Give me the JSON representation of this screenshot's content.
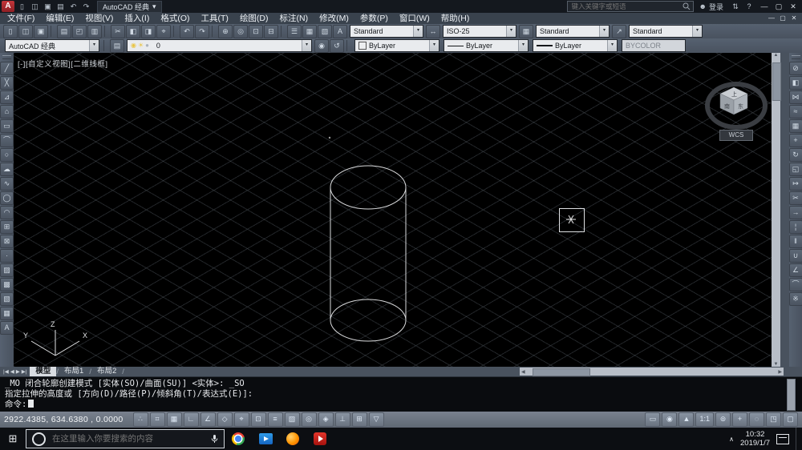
{
  "titlebar": {
    "workspace_label": "AutoCAD 经典",
    "search_placeholder": "键入关键字或短语",
    "signin_label": "登录",
    "qat_icons": [
      {
        "name": "qat-new",
        "g": "▯"
      },
      {
        "name": "qat-open",
        "g": "◫"
      },
      {
        "name": "qat-save",
        "g": "▣"
      },
      {
        "name": "qat-plot",
        "g": "▤"
      },
      {
        "name": "qat-undo",
        "g": "↶"
      },
      {
        "name": "qat-redo",
        "g": "↷"
      }
    ],
    "right_icons": [
      {
        "name": "exchange-apps",
        "g": "⇅"
      },
      {
        "name": "help",
        "g": "?"
      }
    ],
    "window_buttons": [
      {
        "name": "minimize",
        "g": "—"
      },
      {
        "name": "maximize",
        "g": "▢"
      },
      {
        "name": "close",
        "g": "✕"
      }
    ]
  },
  "menubar": {
    "items": [
      "文件(F)",
      "编辑(E)",
      "视图(V)",
      "插入(I)",
      "格式(O)",
      "工具(T)",
      "绘图(D)",
      "标注(N)",
      "修改(M)",
      "参数(P)",
      "窗口(W)",
      "帮助(H)"
    ],
    "doc_window_buttons": [
      {
        "name": "doc-minimize",
        "g": "—"
      },
      {
        "name": "doc-restore",
        "g": "▢"
      },
      {
        "name": "doc-close",
        "g": "✕"
      }
    ]
  },
  "toolbar_style": {
    "icons": [
      {
        "name": "qnew",
        "g": "▯"
      },
      {
        "name": "open",
        "g": "◫"
      },
      {
        "name": "save",
        "g": "▣"
      },
      {
        "sep": true
      },
      {
        "name": "plot",
        "g": "▤"
      },
      {
        "name": "plot-preview",
        "g": "◰"
      },
      {
        "name": "publish",
        "g": "▥"
      },
      {
        "sep": true
      },
      {
        "name": "cut",
        "g": "✂"
      },
      {
        "name": "copy-clip",
        "g": "◧"
      },
      {
        "name": "paste",
        "g": "◨"
      },
      {
        "name": "match-properties",
        "g": "⌖"
      },
      {
        "sep": true
      },
      {
        "name": "undo",
        "g": "↶"
      },
      {
        "name": "redo",
        "g": "↷"
      },
      {
        "sep": true
      },
      {
        "name": "pan-realtime",
        "g": "⊕"
      },
      {
        "name": "zoom-realtime",
        "g": "◎"
      },
      {
        "name": "zoom-window",
        "g": "⊡"
      },
      {
        "name": "zoom-previous",
        "g": "⊟"
      },
      {
        "sep": true
      },
      {
        "name": "properties-palette",
        "g": "☰"
      },
      {
        "name": "design-center",
        "g": "▦"
      },
      {
        "name": "tool-palettes",
        "g": "▧"
      }
    ],
    "combos": {
      "text_style": {
        "label": "Standard",
        "icon": "A"
      },
      "dim_style": {
        "label": "ISO-25",
        "icon": "↔"
      },
      "table_style": {
        "label": "Standard",
        "icon": "▦"
      },
      "mleader_style": {
        "label": "Standard",
        "icon": "↗"
      }
    }
  },
  "toolbar_props": {
    "workspace_label": "AutoCAD 经典",
    "layer_buttons_left": [
      {
        "name": "layer-properties",
        "g": "▤"
      }
    ],
    "layer_statuses": [
      {
        "name": "layer-on",
        "g": "◉",
        "c": "#e9c546"
      },
      {
        "name": "layer-freeze",
        "g": "☀",
        "c": "#e9c546"
      },
      {
        "name": "layer-lock",
        "g": "●",
        "c": "#aab3bd"
      },
      {
        "name": "layer-color",
        "g": "■",
        "c": "#eceef0"
      }
    ],
    "layer_value": "0",
    "layer_buttons_right": [
      {
        "name": "make-object-layer-current",
        "g": "◉"
      },
      {
        "name": "layer-previous",
        "g": "↺"
      }
    ],
    "color_label": "ByLayer",
    "linetype_label": "ByLayer",
    "lineweight_label": "ByLayer",
    "plot_style_label": "BYCOLOR"
  },
  "draw_toolbar": {
    "items": [
      {
        "name": "line",
        "g": "╱"
      },
      {
        "name": "construction-line",
        "g": "╳"
      },
      {
        "name": "polyline",
        "g": "⊿"
      },
      {
        "name": "polygon",
        "g": "⌂"
      },
      {
        "name": "rectangle",
        "g": "▭"
      },
      {
        "name": "arc",
        "g": "⌒"
      },
      {
        "name": "circle",
        "g": "○"
      },
      {
        "name": "revision-cloud",
        "g": "☁"
      },
      {
        "name": "spline",
        "g": "∿"
      },
      {
        "name": "ellipse",
        "g": "◯"
      },
      {
        "name": "ellipse-arc",
        "g": "◠"
      },
      {
        "name": "insert-block",
        "g": "⊞"
      },
      {
        "name": "make-block",
        "g": "⊠"
      },
      {
        "name": "point",
        "g": "∙"
      },
      {
        "name": "hatch",
        "g": "▨"
      },
      {
        "name": "gradient",
        "g": "▩"
      },
      {
        "name": "region",
        "g": "▧"
      },
      {
        "name": "table",
        "g": "▦"
      },
      {
        "name": "multiline-text",
        "g": "A"
      }
    ]
  },
  "modify_toolbar": {
    "items": [
      {
        "name": "erase",
        "g": "⊘"
      },
      {
        "name": "copy",
        "g": "◧"
      },
      {
        "name": "mirror",
        "g": "⋈"
      },
      {
        "name": "offset",
        "g": "≈"
      },
      {
        "name": "array",
        "g": "▦"
      },
      {
        "name": "move",
        "g": "+"
      },
      {
        "name": "rotate",
        "g": "↻"
      },
      {
        "name": "scale",
        "g": "◱"
      },
      {
        "name": "stretch",
        "g": "↦"
      },
      {
        "name": "trim",
        "g": "✂"
      },
      {
        "name": "extend",
        "g": "→"
      },
      {
        "name": "break-at-point",
        "g": "¦"
      },
      {
        "name": "break",
        "g": "‖"
      },
      {
        "name": "join",
        "g": "∪"
      },
      {
        "name": "chamfer",
        "g": "∠"
      },
      {
        "name": "fillet",
        "g": "⌒"
      },
      {
        "name": "explode",
        "g": "※"
      }
    ]
  },
  "viewport": {
    "controls_label": "[-][自定义视图][二维线框]",
    "wcs_label": "WCS",
    "cube": {
      "top": "上",
      "left": "南",
      "right": "东"
    },
    "axes": {
      "x": "X",
      "y": "Y",
      "z": "Z"
    }
  },
  "tabs": {
    "items": [
      "模型",
      "布局1",
      "布局2"
    ],
    "active": "模型",
    "nav": [
      {
        "name": "first-tab",
        "g": "|◀"
      },
      {
        "name": "prev-tab",
        "g": "◀"
      },
      {
        "name": "next-tab",
        "g": "▶"
      },
      {
        "name": "last-tab",
        "g": "▶|"
      }
    ]
  },
  "command": {
    "lines": [
      "_MO 闭合轮廓创建模式 [实体(SO)/曲面(SU)] <实体>: _SO",
      "指定拉伸的高度或 [方向(D)/路径(P)/倾斜角(T)/表达式(E)]:",
      "命令:"
    ]
  },
  "status": {
    "coords": "2922.4385, 634.6380 , 0.0000",
    "left_buttons": [
      {
        "name": "infer-constraints",
        "g": "∴"
      },
      {
        "name": "snap-mode",
        "g": "⌗"
      },
      {
        "name": "grid-display",
        "g": "▦"
      },
      {
        "name": "ortho-mode",
        "g": "∟"
      },
      {
        "name": "polar-tracking",
        "g": "∠"
      },
      {
        "name": "isometric-drafting",
        "g": "◇"
      },
      {
        "name": "object-snap-tracking",
        "g": "⌖"
      },
      {
        "name": "object-snap",
        "g": "⊡"
      },
      {
        "name": "lineweight-display",
        "g": "≡"
      },
      {
        "name": "transparency",
        "g": "▧"
      },
      {
        "name": "selection-cycling",
        "g": "◎"
      },
      {
        "name": "3d-object-snap",
        "g": "◈"
      },
      {
        "name": "dynamic-ucs",
        "g": "⊥"
      },
      {
        "name": "dynamic-input",
        "g": "⊞"
      },
      {
        "name": "quick-properties",
        "g": "▽"
      }
    ],
    "right_buttons": [
      {
        "name": "model-space",
        "g": "▭"
      },
      {
        "name": "annotation-visibility",
        "g": "◉"
      },
      {
        "name": "annotation-autoscale",
        "g": "▲"
      },
      {
        "name": "annotation-scale",
        "t": "1:1"
      },
      {
        "name": "workspace-switching",
        "g": "⊚"
      },
      {
        "name": "annotation-monitor",
        "g": "+"
      },
      {
        "name": "isolate-objects",
        "g": "◌"
      },
      {
        "name": "hardware-acceleration",
        "g": "◳"
      },
      {
        "name": "clean-screen",
        "g": "▢"
      }
    ]
  },
  "taskbar": {
    "search_placeholder": "在这里输入你要搜索的内容",
    "apps": [
      {
        "name": "chrome",
        "shape": "chrome"
      },
      {
        "name": "video-player",
        "shape": "video"
      },
      {
        "name": "firefox",
        "shape": "firefox"
      },
      {
        "name": "media-player",
        "shape": "media"
      }
    ],
    "time": "10:32",
    "date": "2019/1/7"
  },
  "ui": {
    "combo_arrow": "▾",
    "start_glyph": "⊞",
    "chevron_up": "∧",
    "user_glyph": "☻",
    "scroll": {
      "up": "▲",
      "down": "▼",
      "left": "◀",
      "right": "▶"
    }
  }
}
